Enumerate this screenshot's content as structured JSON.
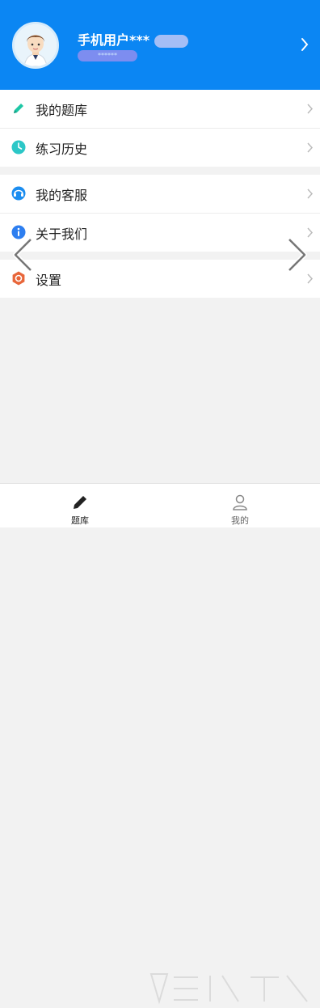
{
  "profile": {
    "username": "手机用户***",
    "masked_sub": "******"
  },
  "menu": {
    "group1": [
      {
        "label": "我的题库",
        "icon": "pencil-icon"
      },
      {
        "label": "练习历史",
        "icon": "clock-icon"
      }
    ],
    "group2": [
      {
        "label": "我的客服",
        "icon": "headset-icon"
      },
      {
        "label": "关于我们",
        "icon": "info-icon"
      }
    ],
    "group3": [
      {
        "label": "设置",
        "icon": "settings-icon"
      }
    ]
  },
  "tabbar": {
    "tabs": [
      {
        "label": "题库",
        "icon": "pencil-icon",
        "active": true
      },
      {
        "label": "我的",
        "icon": "person-icon",
        "active": false
      }
    ]
  },
  "colors": {
    "header_bg": "#0b86f3",
    "active_tab": "#222222",
    "inactive_tab": "#888888",
    "pencil": "#1ec7a6",
    "clock": "#2cc7c7",
    "headset": "#1b8df0",
    "info": "#2d7ef0",
    "settings": "#e8663a"
  }
}
